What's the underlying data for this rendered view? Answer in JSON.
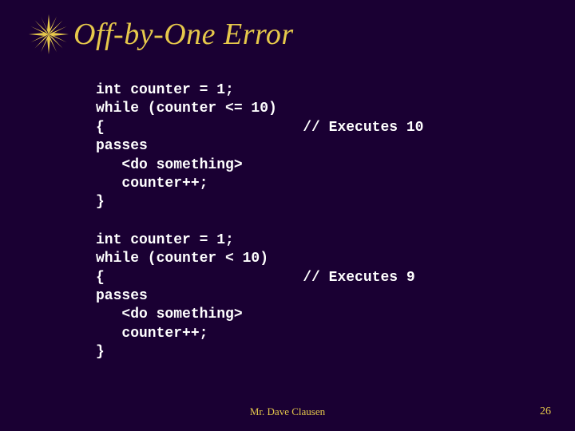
{
  "title": "Off-by-One Error",
  "code_block_1": "int counter = 1;\nwhile (counter <= 10)\n{                       // Executes 10\npasses\n   <do something>\n   counter++;\n}",
  "code_block_2": "int counter = 1;\nwhile (counter < 10)\n{                       // Executes 9\npasses\n   <do something>\n   counter++;\n}",
  "footer": "Mr. Dave Clausen",
  "page_number": "26"
}
